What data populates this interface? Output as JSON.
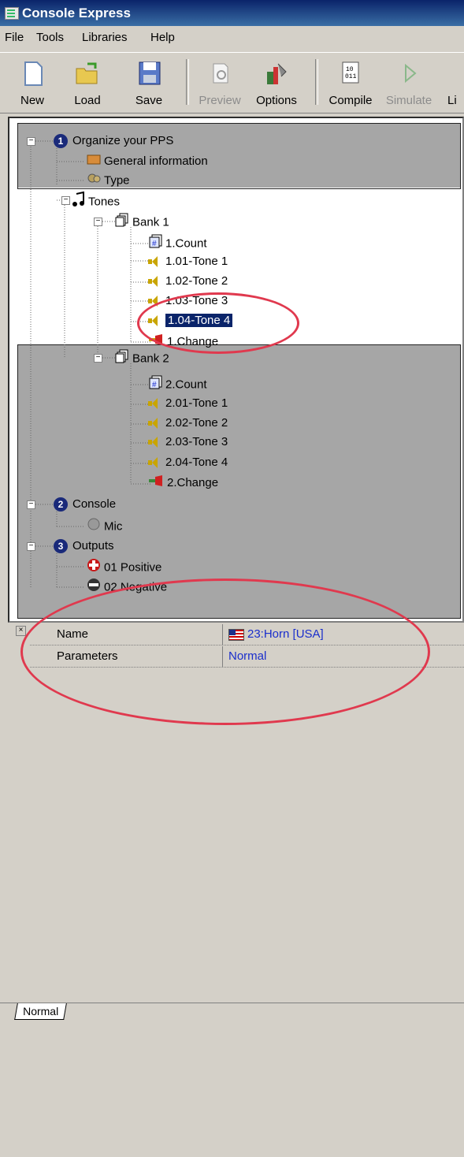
{
  "window": {
    "title": "Console Express"
  },
  "menu": [
    "File",
    "Tools",
    "Libraries",
    "Help"
  ],
  "toolbar": {
    "new": "New",
    "load": "Load",
    "save": "Save",
    "preview": "Preview",
    "options": "Options",
    "compile": "Compile",
    "simulate": "Simulate",
    "more": "Li"
  },
  "tree": {
    "organize": "Organize your PPS",
    "general_info": "General information",
    "type": "Type",
    "tones": "Tones",
    "bank1": "Bank 1",
    "b1_count": "1.Count",
    "b1_t1": "1.01-Tone 1",
    "b1_t2": "1.02-Tone 2",
    "b1_t3": "1.03-Tone 3",
    "b1_t4": "1.04-Tone 4",
    "b1_change": "1.Change",
    "bank2": "Bank 2",
    "b2_count": "2.Count",
    "b2_t1": "2.01-Tone 1",
    "b2_t2": "2.02-Tone 2",
    "b2_t3": "2.03-Tone 3",
    "b2_t4": "2.04-Tone 4",
    "b2_change": "2.Change",
    "console": "Console",
    "mic": "Mic",
    "outputs": "Outputs",
    "positive": "01 Positive",
    "negative": "02 Negative",
    "num1": "1",
    "num2": "2",
    "num3": "3",
    "selected_item": "1.04-Tone 4"
  },
  "properties": {
    "name_label": "Name",
    "name_value": "23:Horn [USA]",
    "params_label": "Parameters",
    "params_value": "Normal"
  },
  "status": {
    "tab": "Normal"
  },
  "colors": {
    "highlight_ring": "#e0394e",
    "selection": "#0a246a",
    "value_text": "#1a2ecc"
  }
}
